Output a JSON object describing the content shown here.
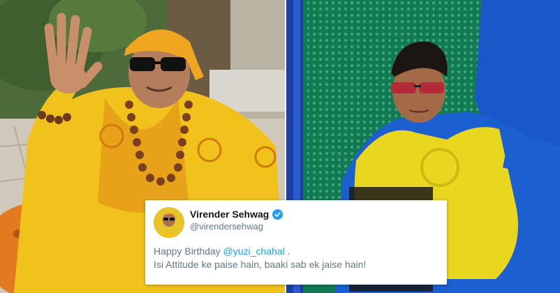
{
  "tweet": {
    "author_name": "Virender Sehwag",
    "handle": "@virendersehwag",
    "line1_prefix": "Happy Birthday ",
    "mention": "@yuzi_chahal",
    "line1_suffix": " .",
    "line2": "Isi Attitude ke paise hain, baaki sab ek jaise hain!"
  },
  "icons": {
    "verified": "verified-badge-icon"
  },
  "colors": {
    "verified_badge": "#1da1f2",
    "mention": "#1da1f2",
    "tweet_text": "#657786",
    "name_text": "#14171a"
  }
}
